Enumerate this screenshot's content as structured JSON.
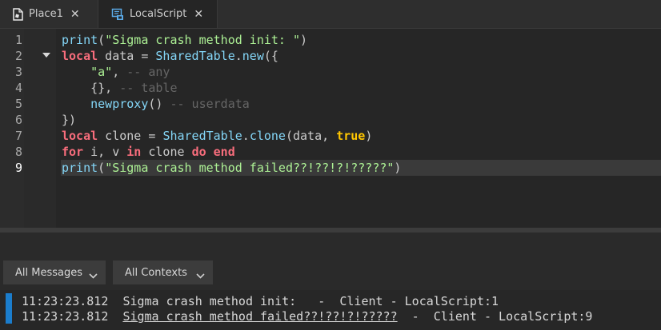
{
  "tabs": [
    {
      "label": "Place1",
      "icon": "place-file-icon",
      "close": "✕"
    },
    {
      "label": "LocalScript",
      "icon": "local-script-icon",
      "close": "✕"
    }
  ],
  "editor": {
    "line_numbers": [
      "1",
      "2",
      "3",
      "4",
      "5",
      "6",
      "7",
      "8",
      "9"
    ],
    "current_line": 9,
    "lines": [
      [
        {
          "t": "print",
          "c": "fn"
        },
        {
          "t": "(",
          "c": "id"
        },
        {
          "t": "\"Sigma crash method init: \"",
          "c": "str"
        },
        {
          "t": ")",
          "c": "id"
        }
      ],
      [
        {
          "t": "local",
          "c": "kw"
        },
        {
          "t": " data = ",
          "c": "id"
        },
        {
          "t": "SharedTable",
          "c": "fn"
        },
        {
          "t": ".",
          "c": "id"
        },
        {
          "t": "new",
          "c": "fn"
        },
        {
          "t": "({",
          "c": "id"
        }
      ],
      [
        {
          "t": "    ",
          "c": "id"
        },
        {
          "t": "\"a\"",
          "c": "str"
        },
        {
          "t": ", ",
          "c": "id"
        },
        {
          "t": "-- any",
          "c": "cm"
        }
      ],
      [
        {
          "t": "    {}, ",
          "c": "id"
        },
        {
          "t": "-- table",
          "c": "cm"
        }
      ],
      [
        {
          "t": "    ",
          "c": "id"
        },
        {
          "t": "newproxy",
          "c": "fn"
        },
        {
          "t": "() ",
          "c": "id"
        },
        {
          "t": "-- userdata",
          "c": "cm"
        }
      ],
      [
        {
          "t": "})",
          "c": "id"
        }
      ],
      [
        {
          "t": "local",
          "c": "kw"
        },
        {
          "t": " clone = ",
          "c": "id"
        },
        {
          "t": "SharedTable",
          "c": "fn"
        },
        {
          "t": ".",
          "c": "id"
        },
        {
          "t": "clone",
          "c": "fn"
        },
        {
          "t": "(data, ",
          "c": "id"
        },
        {
          "t": "true",
          "c": "bool"
        },
        {
          "t": ")",
          "c": "id"
        }
      ],
      [
        {
          "t": "for",
          "c": "kw"
        },
        {
          "t": " i, v ",
          "c": "id"
        },
        {
          "t": "in",
          "c": "kw"
        },
        {
          "t": " clone ",
          "c": "id"
        },
        {
          "t": "do",
          "c": "kw"
        },
        {
          "t": " ",
          "c": "id"
        },
        {
          "t": "end",
          "c": "kw"
        }
      ],
      [
        {
          "t": "print",
          "c": "fn"
        },
        {
          "t": "(",
          "c": "id"
        },
        {
          "t": "\"Sigma crash method failed??!??!?!?????\"",
          "c": "str"
        },
        {
          "t": ")",
          "c": "id"
        }
      ]
    ]
  },
  "filters": {
    "messages_label": "All Messages",
    "contexts_label": "All Contexts"
  },
  "output": {
    "messages": [
      {
        "time": "11:23:23.812",
        "text": "Sigma crash method init:",
        "sep1": "   -  ",
        "context": "Client - LocalScript:1"
      },
      {
        "time": "11:23:23.812",
        "text": "Sigma crash method failed??!??!?!?????",
        "sep1": "  -  ",
        "context": "Client - LocalScript:9"
      }
    ]
  },
  "colors": {
    "keyword": "#f86d7c",
    "builtin": "#84d6f7",
    "string": "#adf195",
    "comment": "#666666",
    "bool": "#ffc600",
    "output_accent": "#1b7dcc"
  }
}
